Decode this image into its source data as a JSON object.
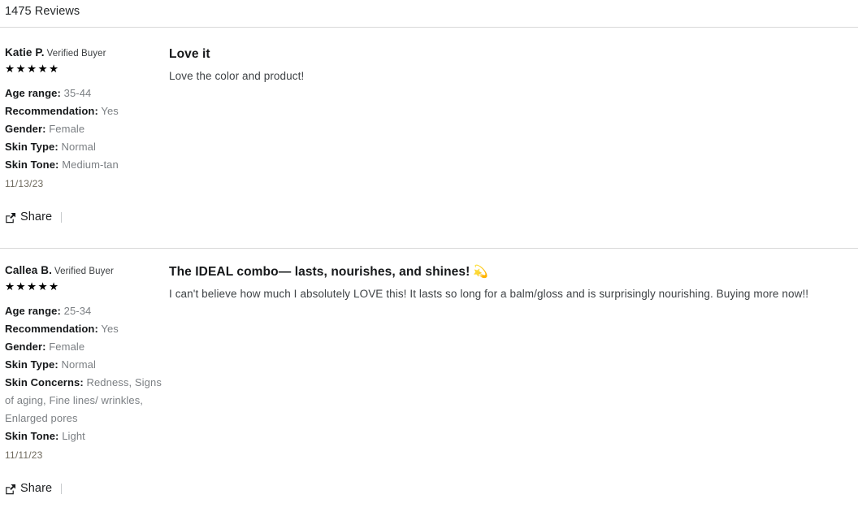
{
  "header": {
    "reviews_count_label": "1475 Reviews"
  },
  "icons": {
    "share": "share-icon"
  },
  "share": {
    "label": "Share"
  },
  "labels": {
    "verified_buyer": "Verified Buyer",
    "stars_5": "★★★★★"
  },
  "reviews": [
    {
      "name": "Katie P.",
      "verified": "Verified Buyer",
      "stars": "★★★★★",
      "rating": 5,
      "meta": [
        {
          "label": "Age range:",
          "value": "35-44"
        },
        {
          "label": "Recommendation:",
          "value": "Yes"
        },
        {
          "label": "Gender:",
          "value": "Female"
        },
        {
          "label": "Skin Type:",
          "value": "Normal"
        },
        {
          "label": "Skin Tone:",
          "value": "Medium-tan"
        }
      ],
      "date": "11/13/23",
      "share_label": "Share",
      "title": "Love it",
      "title_emoji": "",
      "text": "Love the color and product!"
    },
    {
      "name": "Callea B.",
      "verified": "Verified Buyer",
      "stars": "★★★★★",
      "rating": 5,
      "meta": [
        {
          "label": "Age range:",
          "value": "25-34"
        },
        {
          "label": "Recommendation:",
          "value": "Yes"
        },
        {
          "label": "Gender:",
          "value": "Female"
        },
        {
          "label": "Skin Type:",
          "value": "Normal"
        },
        {
          "label": "Skin Concerns:",
          "value": "Redness, Signs of aging, Fine lines/ wrinkles, Enlarged pores"
        },
        {
          "label": "Skin Tone:",
          "value": "Light"
        }
      ],
      "date": "11/11/23",
      "share_label": "Share",
      "title": "The IDEAL combo— lasts, nourishes, and shines!",
      "title_emoji": "💫",
      "text": "I can't believe how much I absolutely LOVE this! It lasts so long for a balm/gloss and is surprisingly nourishing. Buying more now!!"
    }
  ],
  "colors": {
    "text_primary": "#16181a",
    "text_muted": "#7b7f83",
    "divider": "#d8d8d8",
    "date": "#6f6a5e",
    "body_text": "#3e4245"
  }
}
